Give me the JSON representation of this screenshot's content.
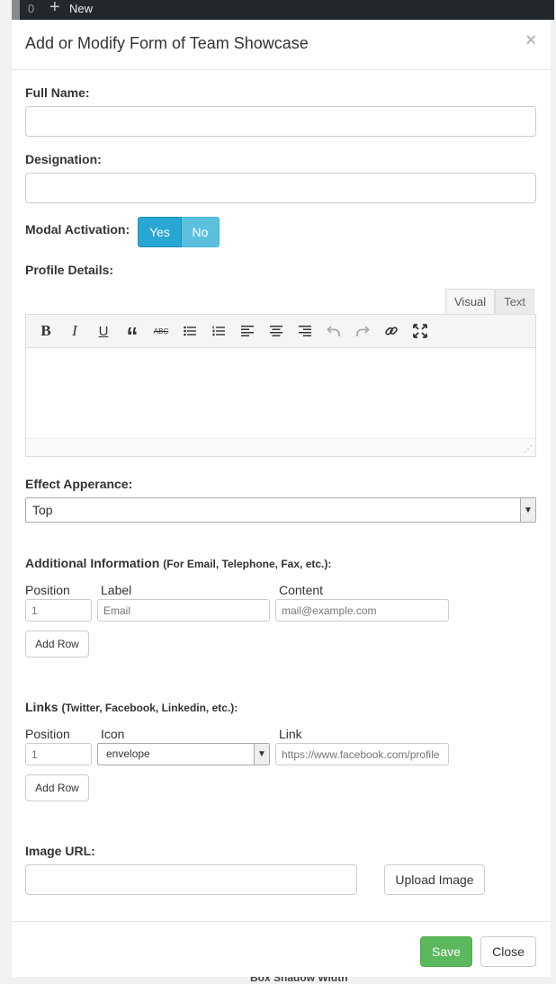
{
  "topbar": {
    "count": "0",
    "new_label": "New"
  },
  "background": {
    "bottom_text": "Box Shadow Width"
  },
  "modal": {
    "title": "Add or Modify Form of Team Showcase",
    "close_label": "×",
    "full_name": {
      "label": "Full Name:",
      "value": ""
    },
    "designation": {
      "label": "Designation:",
      "value": ""
    },
    "modal_activation": {
      "label": "Modal Activation:",
      "yes": "Yes",
      "no": "No",
      "selected": "Yes"
    },
    "profile_details": {
      "label": "Profile Details:",
      "tabs": [
        "Visual",
        "Text"
      ],
      "active_tab": "Visual",
      "content": ""
    },
    "effect": {
      "label": "Effect Apperance:",
      "selected": "Top"
    },
    "additional": {
      "label": "Additional Information",
      "hint": "(For Email, Telephone, Fax, etc.):",
      "columns": [
        "Position",
        "Label",
        "Content"
      ],
      "row": {
        "position_placeholder": "1",
        "label_placeholder": "Email",
        "content_placeholder": "mail@example.com"
      },
      "add_row": "Add Row"
    },
    "links": {
      "label": "Links",
      "hint": "(Twitter, Facebook, Linkedin, etc.):",
      "columns": [
        "Position",
        "Icon",
        "Link"
      ],
      "row": {
        "position_placeholder": "1",
        "icon_selected": "envelope",
        "link_placeholder": "https://www.facebook.com/profile"
      },
      "add_row": "Add Row"
    },
    "image": {
      "label": "Image URL:",
      "value": "",
      "upload_label": "Upload Image"
    },
    "footer": {
      "save": "Save",
      "close": "Close"
    }
  },
  "colors": {
    "toggle_yes": "#28a7d4",
    "toggle_no": "#5bc0de",
    "save": "#5cb85c"
  }
}
